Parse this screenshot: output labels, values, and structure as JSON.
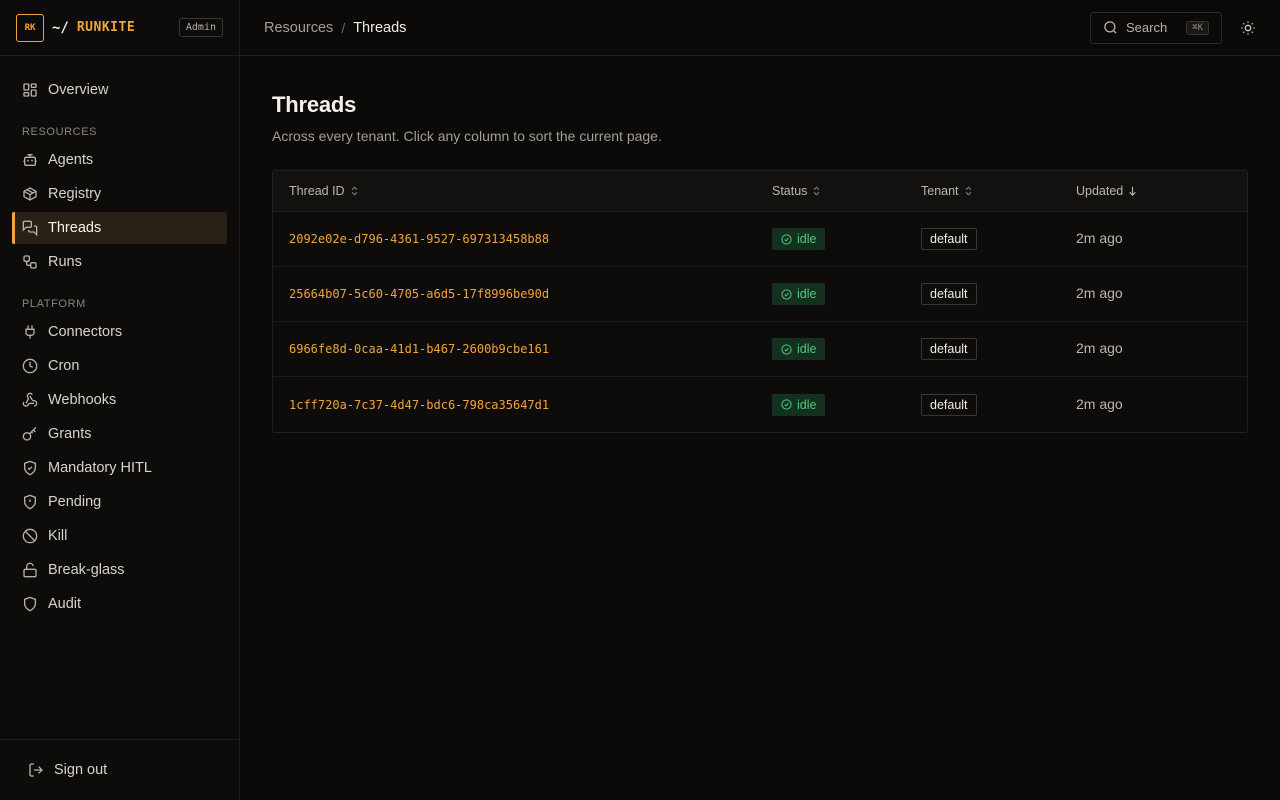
{
  "brand": {
    "logo_text": "RK",
    "prefix": "~/",
    "name": "RUNKITE",
    "role_badge": "Admin"
  },
  "sidebar": {
    "overview": {
      "label": "Overview",
      "icon": "dashboard-icon"
    },
    "resources_heading": "RESOURCES",
    "resources": [
      {
        "label": "Agents",
        "icon": "bot-icon"
      },
      {
        "label": "Registry",
        "icon": "package-icon"
      },
      {
        "label": "Threads",
        "icon": "messages-icon",
        "active": true
      },
      {
        "label": "Runs",
        "icon": "workflow-icon"
      }
    ],
    "platform_heading": "PLATFORM",
    "platform": [
      {
        "label": "Connectors",
        "icon": "plug-icon"
      },
      {
        "label": "Cron",
        "icon": "clock-icon"
      },
      {
        "label": "Webhooks",
        "icon": "webhook-icon"
      },
      {
        "label": "Grants",
        "icon": "key-icon"
      },
      {
        "label": "Mandatory HITL",
        "icon": "shield-check-icon"
      },
      {
        "label": "Pending",
        "icon": "shield-alert-icon"
      },
      {
        "label": "Kill",
        "icon": "ban-icon"
      },
      {
        "label": "Break-glass",
        "icon": "lock-open-icon"
      },
      {
        "label": "Audit",
        "icon": "shield-icon"
      }
    ],
    "signout_label": "Sign out"
  },
  "header": {
    "breadcrumb": [
      "Resources",
      "Threads"
    ],
    "search_label": "Search",
    "search_shortcut": "⌘K"
  },
  "page": {
    "title": "Threads",
    "subtitle": "Across every tenant. Click any column to sort the current page."
  },
  "table": {
    "columns": [
      "Thread ID",
      "Status",
      "Tenant",
      "Updated"
    ],
    "sorted_column": "Updated",
    "sort_direction": "desc",
    "rows": [
      {
        "thread_id": "2092e02e-d796-4361-9527-697313458b88",
        "status": "idle",
        "tenant": "default",
        "updated": "2m ago"
      },
      {
        "thread_id": "25664b07-5c60-4705-a6d5-17f8996be90d",
        "status": "idle",
        "tenant": "default",
        "updated": "2m ago"
      },
      {
        "thread_id": "6966fe8d-0caa-41d1-b467-2600b9cbe161",
        "status": "idle",
        "tenant": "default",
        "updated": "2m ago"
      },
      {
        "thread_id": "1cff720a-7c37-4d47-bdc6-798ca35647d1",
        "status": "idle",
        "tenant": "default",
        "updated": "2m ago"
      }
    ]
  },
  "colors": {
    "accent": "#f0a43a",
    "status_ok": "#4cc97e",
    "background": "#0b0a09"
  }
}
